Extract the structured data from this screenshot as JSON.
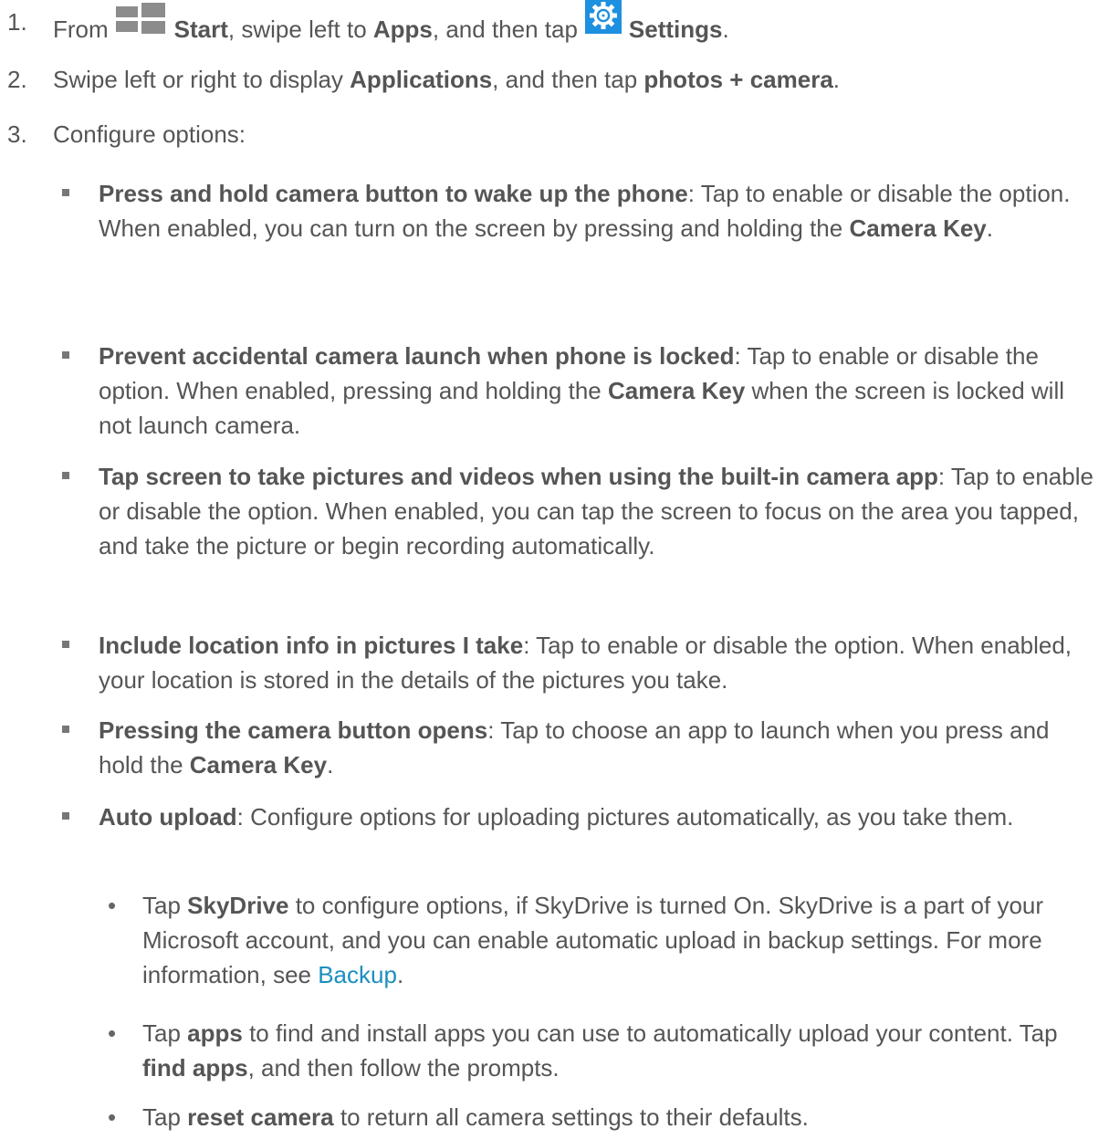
{
  "steps": [
    {
      "num": "1.",
      "parts": [
        "From",
        "Start",
        ", swipe left to ",
        "Apps",
        ", and then tap",
        "Settings",
        "."
      ]
    },
    {
      "num": "2.",
      "parts": [
        "Swipe left or right to display ",
        "Applications",
        ", and then tap ",
        "photos + camera",
        "."
      ]
    },
    {
      "num": "3.",
      "parts": [
        "Configure options:"
      ]
    }
  ],
  "options": [
    {
      "title": "Press and hold camera button to wake up the phone",
      "body_a": ": Tap to enable or disable the option. When enabled, you can turn on the screen by pressing and holding the ",
      "bold": "Camera Key",
      "body_b": "."
    },
    {
      "title": "Prevent accidental camera launch when phone is locked",
      "body_a": ": Tap to enable or disable the option. When enabled, pressing and holding the ",
      "bold": "Camera Key",
      "body_b": " when the screen is locked will not launch camera."
    },
    {
      "title": "Tap screen to take pictures and videos when using the built-in camera app",
      "body_a": ": Tap to enable or disable the option. When enabled, you can tap the screen to focus on the area you tapped, and take the picture or begin recording automatically."
    },
    {
      "title": "Include location info in pictures I take",
      "body_a": ": Tap to enable or disable the option. When enabled, your location is stored in the details of the pictures you take."
    },
    {
      "title": "Pressing the camera button opens",
      "body_a": ": Tap to choose an app to launch when you press and hold the ",
      "bold": "Camera Key",
      "body_b": "."
    },
    {
      "title": "Auto upload",
      "body_a": ": Configure options for uploading pictures automatically, as you take them."
    }
  ],
  "subitems": [
    {
      "pre": "Tap ",
      "bold": "SkyDrive",
      "post": " to configure options, if SkyDrive is turned On. SkyDrive is a part of your Microsoft account, and you can enable automatic upload in backup settings. For more information, see ",
      "link": "Backup",
      "end": "."
    },
    {
      "pre": "Tap ",
      "bold": "apps",
      "post": " to find and install apps you can use to automatically upload your content. Tap ",
      "bold2": "find apps",
      "end": ", and then follow the prompts."
    },
    {
      "pre": "Tap ",
      "bold": "reset camera",
      "end": " to return all camera settings to their defaults."
    }
  ],
  "icons": {
    "start": "windows-start-icon",
    "settings": "settings-gear-icon",
    "settings_color": "#1e90e0"
  }
}
